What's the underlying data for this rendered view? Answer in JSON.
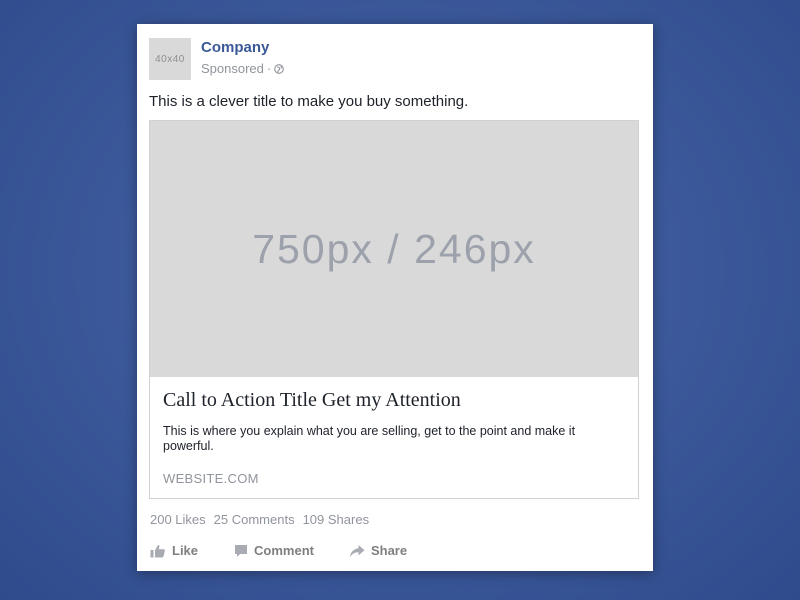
{
  "post": {
    "avatar_text": "40x40",
    "company_name": "Company",
    "sponsored_label": "Sponsored",
    "separator": "·",
    "message": "This is a clever title to make you buy something."
  },
  "card": {
    "image_placeholder": "750px / 246px",
    "title": "Call to Action Title Get my Attention",
    "description": "This is where you explain what you are selling, get to the point and make it powerful.",
    "website": "WEBSITE.COM"
  },
  "stats": {
    "likes": "200 Likes",
    "comments": "25 Comments",
    "shares": "109 Shares"
  },
  "actions": {
    "like_label": "Like",
    "comment_label": "Comment",
    "share_label": "Share"
  },
  "icons": {
    "globe": "globe-icon",
    "like": "thumbs-up-icon",
    "comment": "comment-bubble-icon",
    "share": "share-arrow-icon"
  },
  "colors": {
    "background": "#3d5a9c",
    "brand_link": "#3b5998",
    "muted_text": "#90949c",
    "placeholder_gray": "#d9d9d9"
  }
}
